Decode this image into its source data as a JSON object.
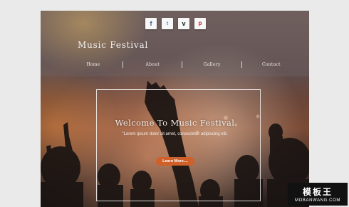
{
  "social": [
    {
      "name": "facebook-icon",
      "glyph": "f"
    },
    {
      "name": "twitter-icon",
      "glyph": "t"
    },
    {
      "name": "vimeo-icon",
      "glyph": "v"
    },
    {
      "name": "pinterest-icon",
      "glyph": "p"
    }
  ],
  "brand": "Music Festival",
  "nav": [
    "Home",
    "About",
    "Gallery",
    "Contact"
  ],
  "hero": {
    "title": "Welcome To Music Festival",
    "subtitle": "\"Lorem ipsum dolor sit amet, consectetur adipiscing elit.",
    "button": "Learn More...."
  },
  "watermark": {
    "cn": "模板王",
    "en": "MOBANWANG.COM"
  },
  "colors": {
    "accent": "#d0602a"
  }
}
